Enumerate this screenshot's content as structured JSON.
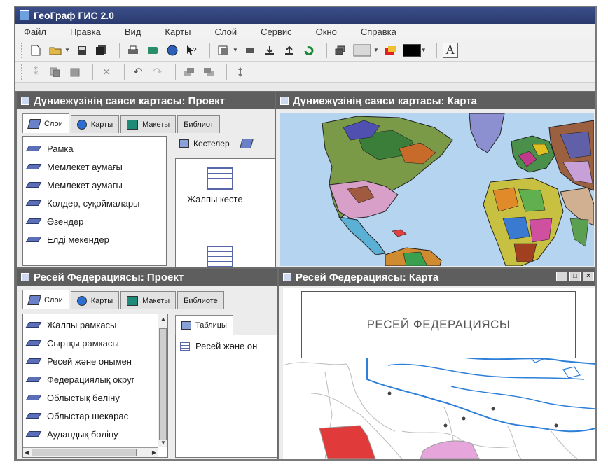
{
  "app": {
    "title": "ГеоГраф ГИС 2.0"
  },
  "menu": [
    "Файл",
    "Правка",
    "Вид",
    "Карты",
    "Слой",
    "Сервис",
    "Окно",
    "Справка"
  ],
  "toolbar": {
    "colors": {
      "fill": "#e02020",
      "line": "#000000"
    },
    "text_tool": "A"
  },
  "world_project": {
    "title": "Дүниежүзінің саяси картасы: Проект",
    "tabs": [
      "Слои",
      "Карты",
      "Макеты",
      "Библиот"
    ],
    "layers": [
      "Рамка",
      "Мемлекет аумағы",
      "Мемлекет аумағы",
      "Көлдер, суқоймалары",
      "Өзендер",
      "Елді мекендер"
    ],
    "subtab": "Кестелер",
    "table_label": "Жалпы кесте"
  },
  "world_map": {
    "title": "Дүниежүзінің саяси картасы: Карта"
  },
  "russia_project": {
    "title": "Ресей Федерациясы: Проект",
    "tabs": [
      "Слои",
      "Карты",
      "Макеты",
      "Библиоте"
    ],
    "layers": [
      "Жалпы рамкасы",
      "Сыртқы рамкасы",
      "Ресей және онымен",
      "Федерациялық округ",
      "Облыстық бөліну",
      "Облыстар шекарас",
      "Аудандық бөліну"
    ],
    "subtab": "Таблицы",
    "table_item": "Ресей және он"
  },
  "russia_map": {
    "title": "Ресей Федерациясы: Карта",
    "heading": "РЕСЕЙ ФЕДЕРАЦИЯСЫ"
  }
}
